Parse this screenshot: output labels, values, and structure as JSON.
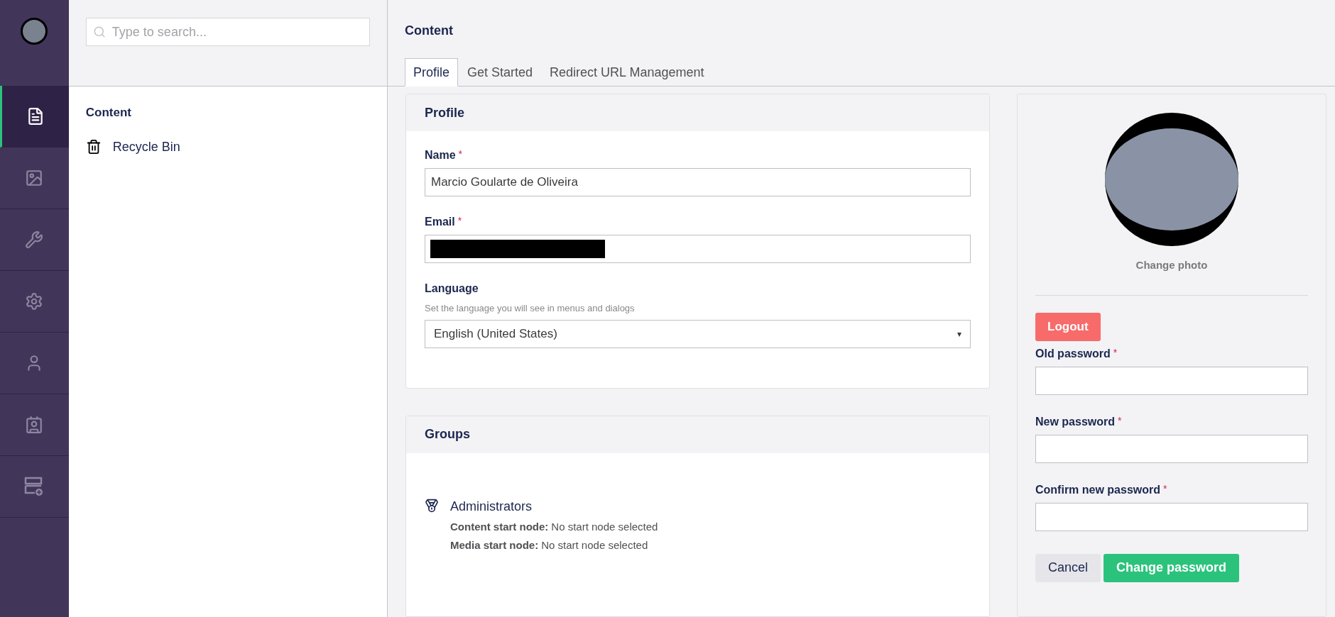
{
  "sections": [
    {
      "selected": true
    },
    {
      "selected": false
    },
    {
      "selected": false
    },
    {
      "selected": false
    },
    {
      "selected": false
    },
    {
      "selected": false
    },
    {
      "selected": false
    }
  ],
  "tree": {
    "search": {
      "placeholder": "Type to search..."
    },
    "title": "Content",
    "items": [
      {
        "label": "Recycle Bin"
      }
    ]
  },
  "header": {
    "title": "Content"
  },
  "tabs": [
    {
      "label": "Profile",
      "selected": true
    },
    {
      "label": "Get Started",
      "selected": false
    },
    {
      "label": "Redirect URL Management",
      "selected": false
    }
  ],
  "profile": {
    "title": "Profile",
    "fields": [
      {
        "kind": "text",
        "label": "Name",
        "required_mark": "*",
        "value": "Marcio Goularte de Oliveira"
      },
      {
        "kind": "redacted",
        "label": "Email",
        "required_mark": "*"
      },
      {
        "kind": "select",
        "label": "Language",
        "description": "Set the language you will see in menus and dialogs",
        "value": "English (United States)",
        "caret": "▾"
      }
    ]
  },
  "groups": {
    "title": "Groups",
    "items": [
      {
        "name": "Administrators",
        "details": [
          {
            "label": "Content start node:",
            "value": "No start node selected"
          },
          {
            "label": "Media start node:",
            "value": "No start node selected"
          }
        ]
      }
    ]
  },
  "account": {
    "change_photo": "Change photo",
    "logout": "Logout",
    "fields": [
      {
        "label": "Old password",
        "required_mark": "*"
      },
      {
        "label": "New password",
        "required_mark": "*"
      },
      {
        "label": "Confirm new password",
        "required_mark": "*"
      }
    ],
    "cancel": "Cancel",
    "submit": "Change password"
  }
}
